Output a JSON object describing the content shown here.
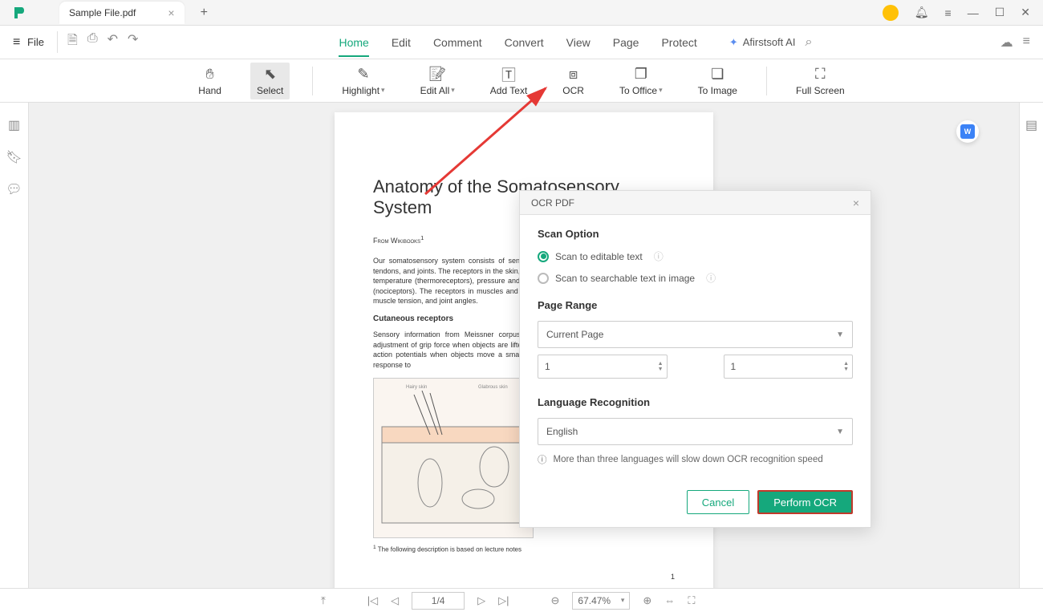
{
  "tab": {
    "title": "Sample File.pdf"
  },
  "menu": {
    "file": "File"
  },
  "main_tabs": [
    "Home",
    "Edit",
    "Comment",
    "Convert",
    "View",
    "Page",
    "Protect"
  ],
  "active_tab": 0,
  "ai_label": "Afirstsoft AI",
  "tools": {
    "hand": "Hand",
    "select": "Select",
    "highlight": "Highlight",
    "edit_all": "Edit All",
    "add_text": "Add Text",
    "ocr": "OCR",
    "to_office": "To Office",
    "to_image": "To Image",
    "full_screen": "Full Screen"
  },
  "doc": {
    "title": "Anatomy of the Somatosensory System",
    "subtitle": "From Wikibooks",
    "superscript": "1",
    "para1": "Our somatosensory system consists of sensors in the skin and sensors in our muscles, tendons, and joints. The receptors in the skin, the so called cutaneous receptors, tell us about temperature (thermoreceptors), pressure and surface texture (mechano receptors), and pain (nociceptors). The receptors in muscles and joints provide information about muscle length, muscle tension, and joint angles.",
    "heading2": "Cutaneous receptors",
    "para2": "Sensory information from Meissner corpuscles and rapidly adapting afferents leads to adjustment of grip force when objects are lifted. These afferents respond with a brief burst of action potentials when objects move a small distance during the early stages of lifting. In response to",
    "footnote": "The following description is based on lecture notes",
    "page_number": "1"
  },
  "dialog": {
    "title": "OCR PDF",
    "scan_option_label": "Scan Option",
    "radio1": "Scan to editable text",
    "radio2": "Scan to searchable text in image",
    "page_range_label": "Page Range",
    "page_range_value": "Current Page",
    "range_from": "1",
    "range_to": "1",
    "lang_label": "Language Recognition",
    "lang_value": "English",
    "hint": "More than three languages will slow down OCR recognition speed",
    "cancel": "Cancel",
    "perform": "Perform OCR"
  },
  "status": {
    "page": "1/4",
    "zoom": "67.47%"
  }
}
